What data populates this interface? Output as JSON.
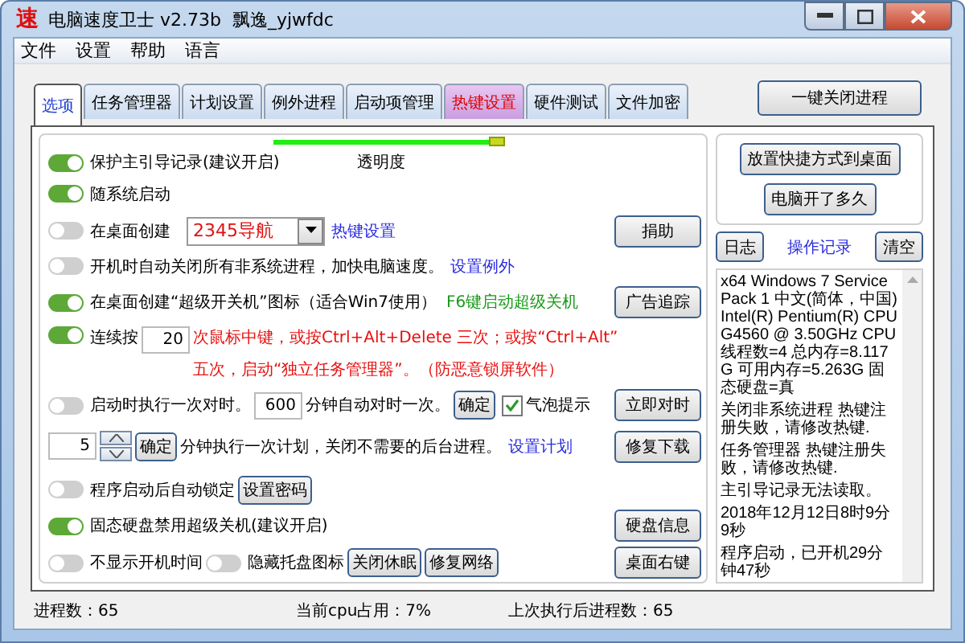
{
  "window": {
    "logo": "速",
    "title": "电脑速度卫士 v2.73b  飘逸_yjwfdc"
  },
  "menu": [
    "文件",
    "设置",
    "帮助",
    "语言"
  ],
  "tabs": [
    {
      "label": "选项",
      "selected": true,
      "kind": "normal"
    },
    {
      "label": "任务管理器",
      "selected": false,
      "kind": "normal"
    },
    {
      "label": "计划设置",
      "selected": false,
      "kind": "normal"
    },
    {
      "label": "例外进程",
      "selected": false,
      "kind": "normal"
    },
    {
      "label": "启动项管理",
      "selected": false,
      "kind": "normal"
    },
    {
      "label": "热键设置",
      "selected": false,
      "kind": "highlight"
    },
    {
      "label": "硬件测试",
      "selected": false,
      "kind": "normal"
    },
    {
      "label": "文件加密",
      "selected": false,
      "kind": "normal"
    }
  ],
  "top_button": "一键关闭进程",
  "transparency": {
    "level": 0.94
  },
  "rows": [
    {
      "items": [
        {
          "kind": "toggle",
          "label": "保护主引导记录(建议开启)",
          "on": true
        },
        {
          "kind": "caption",
          "text": "透明度"
        }
      ]
    },
    {
      "items": [
        {
          "kind": "toggle",
          "label": "随系统启动",
          "on": true
        }
      ]
    },
    {
      "items": [
        {
          "kind": "toggle",
          "label": "在桌面创建",
          "on": false
        },
        {
          "kind": "select",
          "value": "2345导航"
        },
        {
          "kind": "link",
          "text": "热键设置"
        }
      ],
      "action": "捐助"
    },
    {
      "items": [
        {
          "kind": "toggle",
          "label": "开机时自动关闭所有非系统进程，加快电脑速度。",
          "on": false
        },
        {
          "kind": "link",
          "text": "设置例外"
        }
      ]
    },
    {
      "items": [
        {
          "kind": "toggle",
          "label": "在桌面创建“超级开关机”图标（适合Win7使用）",
          "on": true
        },
        {
          "kind": "hint",
          "text": "F6键启动超级关机"
        }
      ],
      "action": "广告追踪"
    },
    {
      "items": [
        {
          "kind": "toggle",
          "label": "连续按",
          "on": true
        },
        {
          "kind": "input",
          "value": "20"
        },
        {
          "kind": "note",
          "lines": [
            "次鼠标中键，或按Ctrl+Alt+Delete 三次；或按“Ctrl+Alt”",
            "五次，启动“独立任务管理器”。（防恶意锁屏软件）"
          ]
        }
      ]
    },
    {
      "items": [
        {
          "kind": "toggle",
          "label": "启动时执行一次对时。",
          "on": false
        },
        {
          "kind": "input",
          "value": "600"
        },
        {
          "kind": "text",
          "text": "分钟自动对时一次。"
        },
        {
          "kind": "button",
          "label": "确定"
        },
        {
          "kind": "checkbox",
          "label": "气泡提示",
          "checked": true
        }
      ],
      "action": "立即对时"
    },
    {
      "items": [
        {
          "kind": "spinner",
          "value": "5"
        },
        {
          "kind": "button",
          "label": "确定"
        },
        {
          "kind": "text",
          "text": "分钟执行一次计划，关闭不需要的后台进程。"
        },
        {
          "kind": "link",
          "text": "设置计划"
        }
      ],
      "action": "修复下载"
    },
    {
      "items": [
        {
          "kind": "toggle",
          "label": "程序启动后自动锁定",
          "on": false
        },
        {
          "kind": "button",
          "label": "设置密码"
        }
      ]
    },
    {
      "items": [
        {
          "kind": "toggle",
          "label": "固态硬盘禁用超级关机(建议开启)",
          "on": true
        }
      ],
      "action": "硬盘信息"
    },
    {
      "items": [
        {
          "kind": "toggle",
          "label": "不显示开机时间",
          "on": false
        },
        {
          "kind": "toggle",
          "label": "隐藏托盘图标",
          "on": false
        },
        {
          "kind": "button",
          "label": "关闭休眠"
        },
        {
          "kind": "button",
          "label": "修复网络"
        }
      ],
      "action": "桌面右键"
    }
  ],
  "side_panel": {
    "buttons": [
      "放置快捷方式到桌面",
      "电脑开了多久"
    ],
    "log_controls": {
      "left": "日志",
      "title": "操作记录",
      "right": "清空"
    },
    "log": [
      "x64 Windows 7 Service Pack 1 中文(简体，中国)Intel(R) Pentium(R) CPU G4560 @ 3.50GHz CPU线程数=4 总内存=8.117G 可用内存=5.263G 固态硬盘=真",
      "关闭非系统进程 热键注册失败，请修改热键.",
      "任务管理器 热键注册失败，请修改热键.",
      "主引导记录无法读取。",
      "2018年12月12日8时9分9秒",
      "程序启动，已开机29分钟47秒"
    ]
  },
  "status_bar": [
    "进程数：65",
    "当前cpu占用：7%",
    "上次执行后进程数：65"
  ]
}
